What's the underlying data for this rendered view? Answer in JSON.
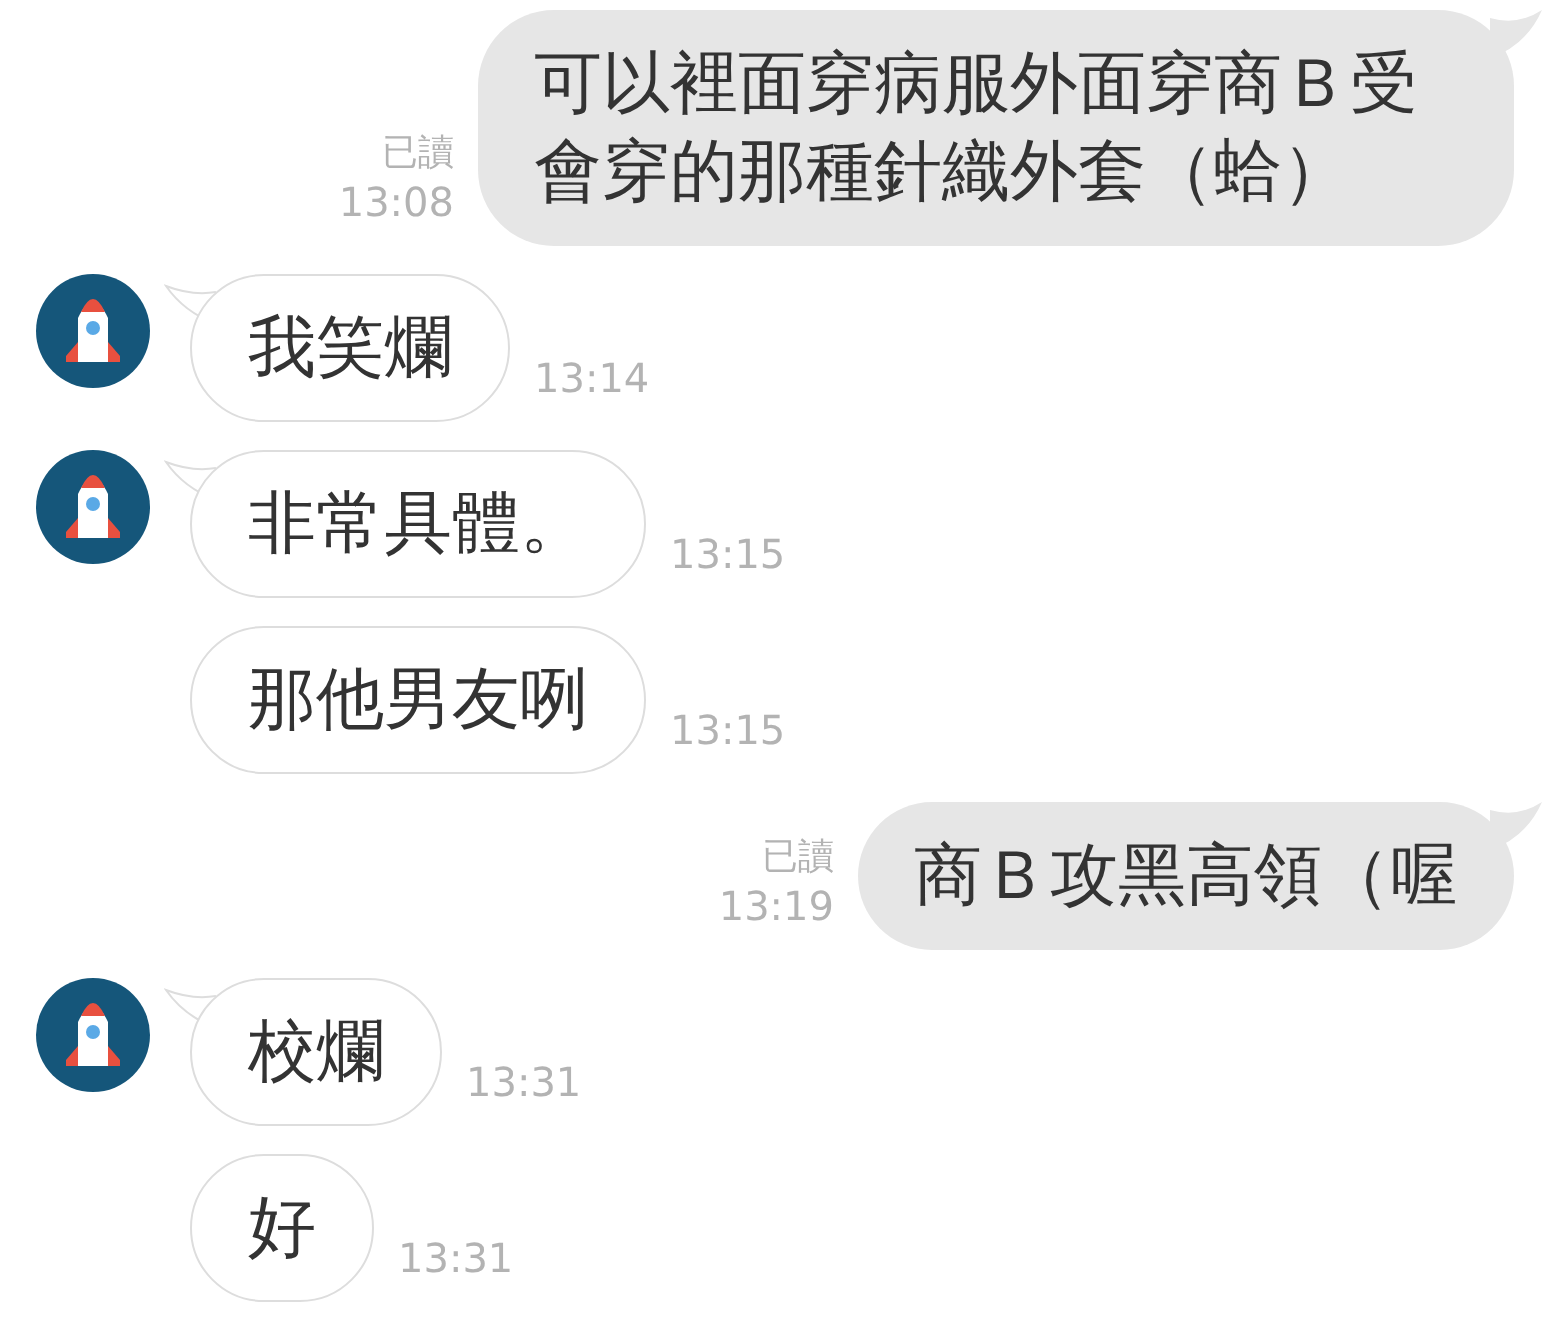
{
  "messages": [
    {
      "kind": "out",
      "text": "可以裡面穿病服外面穿商Ｂ受會穿的那種針織外套（蛤）",
      "read_label": "已讀",
      "time": "13:08"
    },
    {
      "kind": "in",
      "avatar": true,
      "text": "我笑爛",
      "time": "13:14"
    },
    {
      "kind": "in",
      "avatar": true,
      "text": "非常具體。",
      "time": "13:15"
    },
    {
      "kind": "in",
      "avatar": false,
      "text": "那他男友咧",
      "time": "13:15"
    },
    {
      "kind": "out",
      "text": "商Ｂ攻黑高領（喔",
      "read_label": "已讀",
      "time": "13:19"
    },
    {
      "kind": "in",
      "avatar": true,
      "text": "校爛",
      "time": "13:31"
    },
    {
      "kind": "in",
      "avatar": false,
      "text": "好",
      "time": "13:31"
    }
  ]
}
